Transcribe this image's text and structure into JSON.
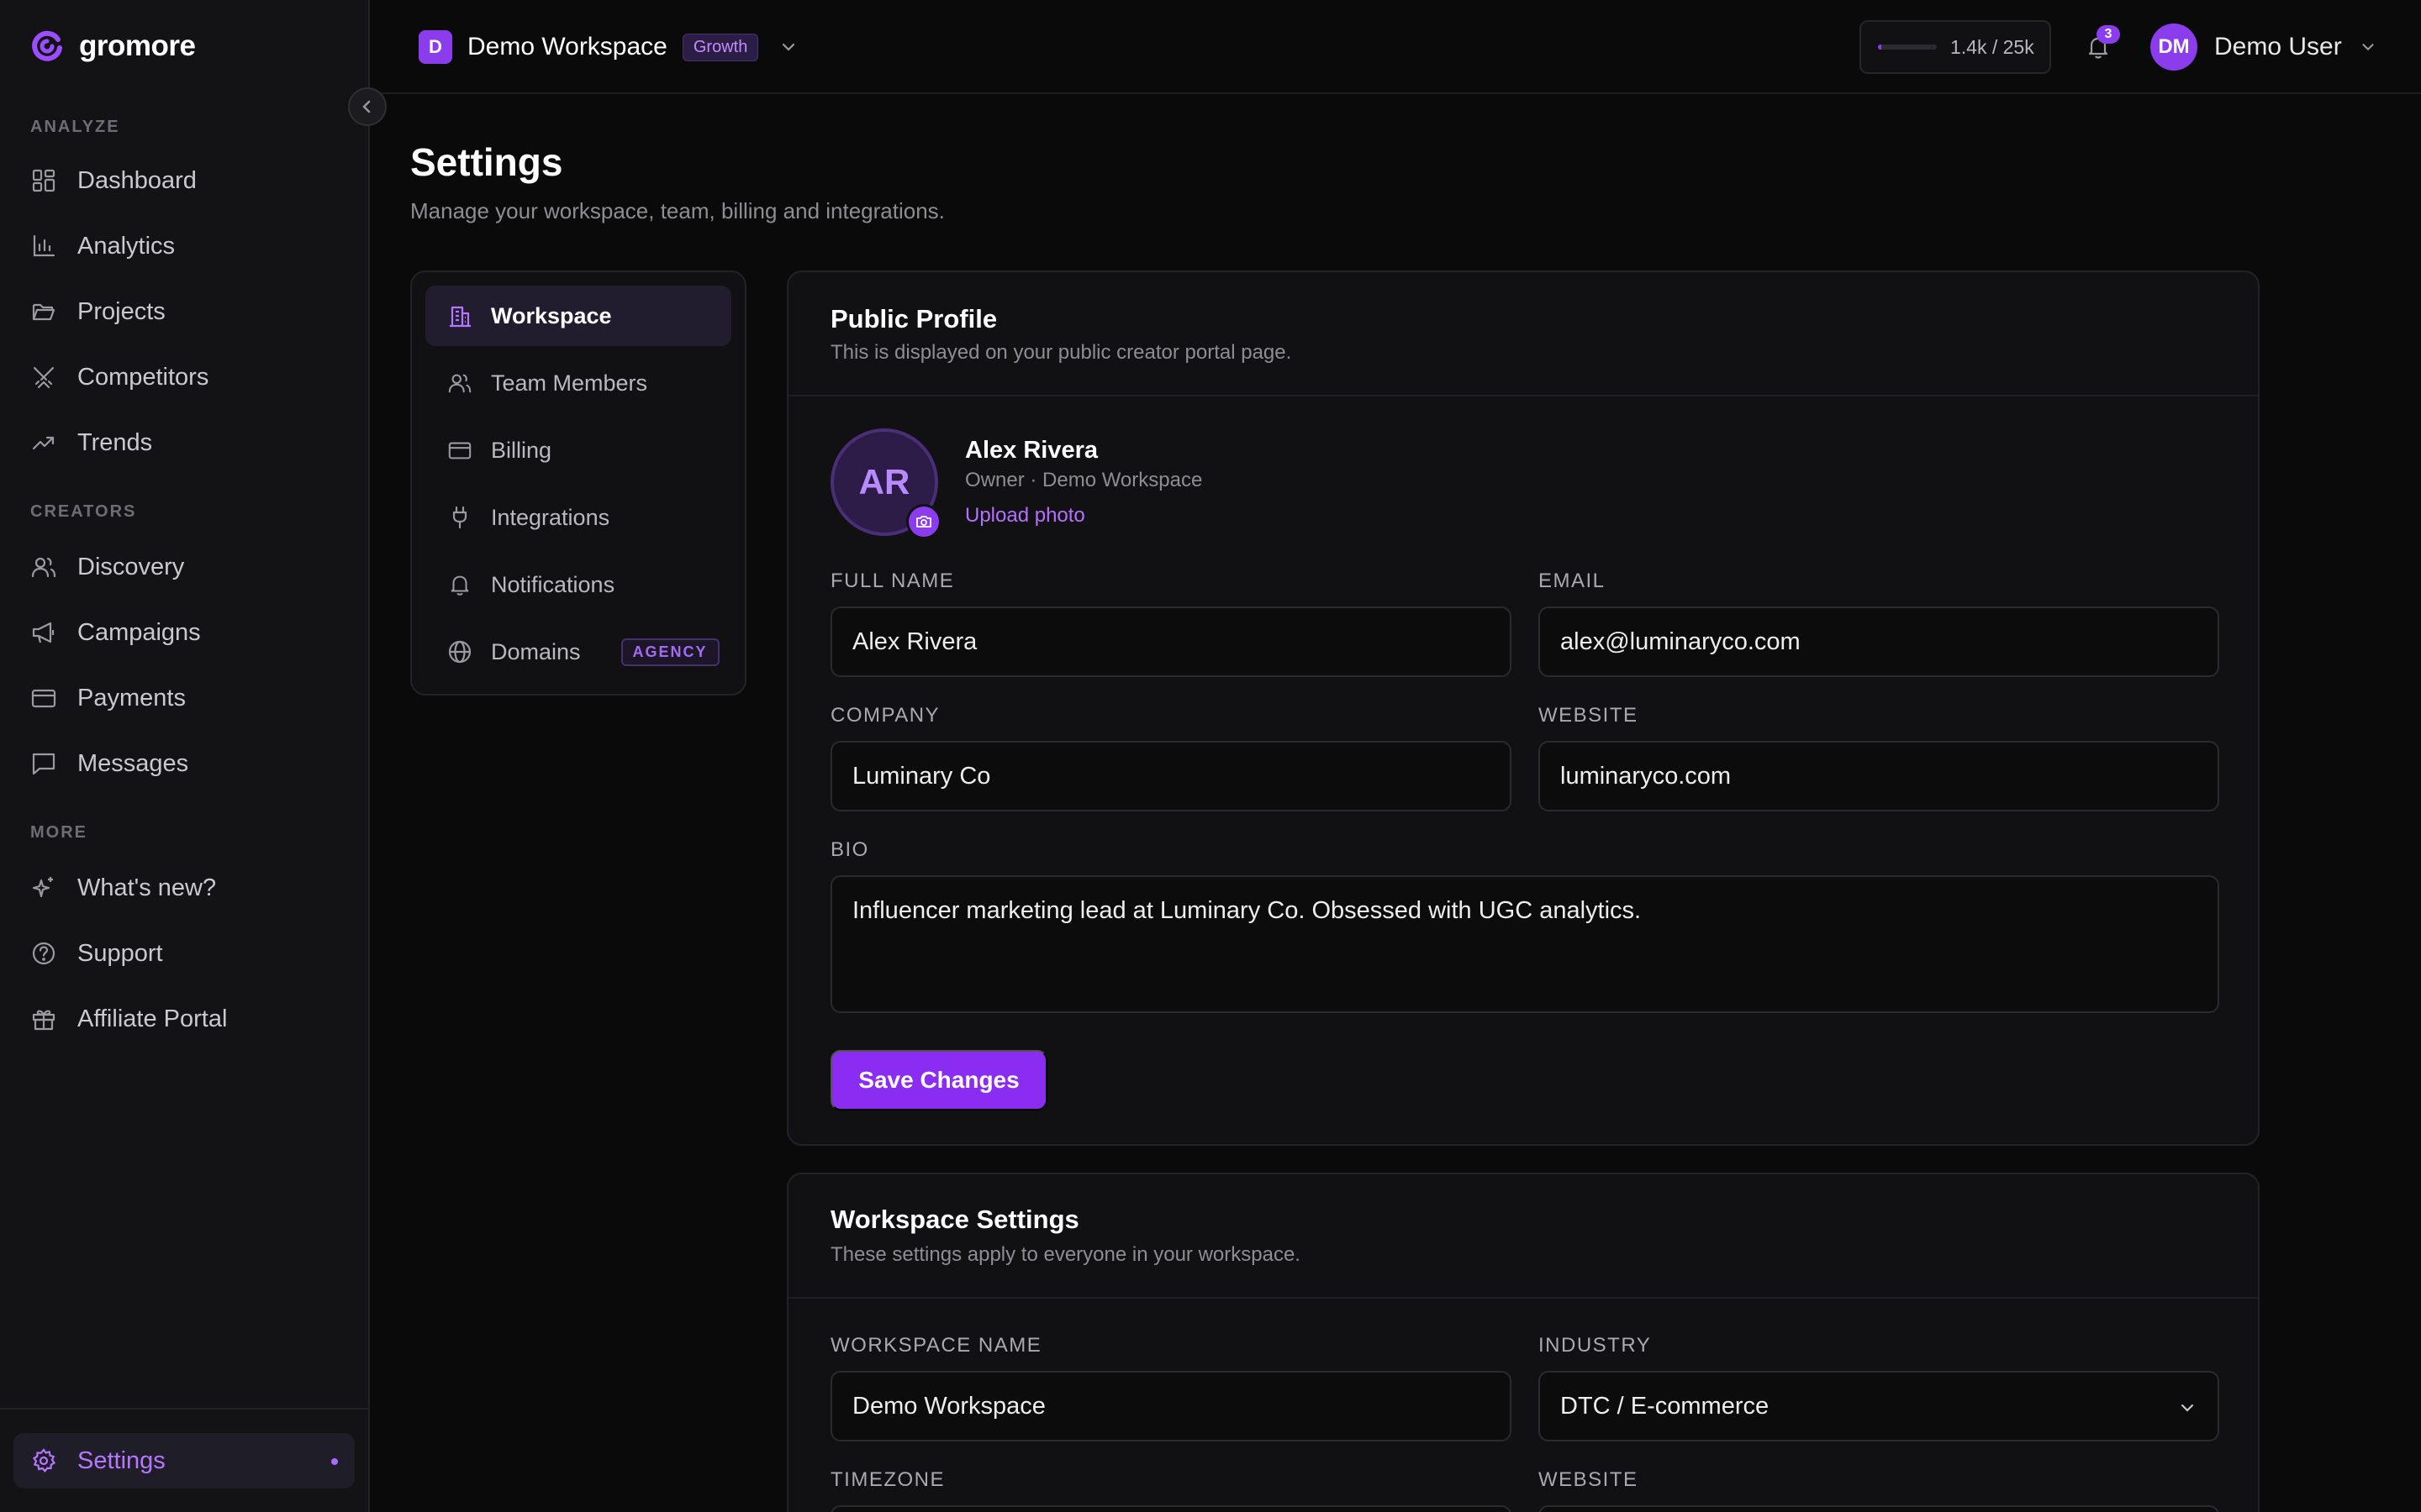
{
  "app": {
    "logo_text": "gromore"
  },
  "sidebar": {
    "sections": [
      {
        "label": "ANALYZE"
      },
      {
        "label": "CREATORS"
      },
      {
        "label": "MORE"
      }
    ],
    "items": [
      {
        "label": "Dashboard",
        "icon": "dashboard-icon"
      },
      {
        "label": "Analytics",
        "icon": "analytics-icon"
      },
      {
        "label": "Projects",
        "icon": "folder-icon"
      },
      {
        "label": "Competitors",
        "icon": "swords-icon"
      },
      {
        "label": "Trends",
        "icon": "trending-up-icon"
      },
      {
        "label": "Discovery",
        "icon": "users-icon"
      },
      {
        "label": "Campaigns",
        "icon": "megaphone-icon"
      },
      {
        "label": "Payments",
        "icon": "credit-card-icon"
      },
      {
        "label": "Messages",
        "icon": "message-icon"
      },
      {
        "label": "What's new?",
        "icon": "sparkles-icon"
      },
      {
        "label": "Support",
        "icon": "help-circle-icon"
      },
      {
        "label": "Affiliate Portal",
        "icon": "gift-icon"
      }
    ],
    "settings": {
      "label": "Settings",
      "icon": "gear-icon",
      "active": true
    }
  },
  "topbar": {
    "workspace_initial": "D",
    "workspace_name": "Demo Workspace",
    "plan": "Growth",
    "usage_text": "1.4k / 25k",
    "usage_fraction": 0.056,
    "notification_count": "3",
    "user_initials": "DM",
    "user_name": "Demo User"
  },
  "page": {
    "title": "Settings",
    "subtitle": "Manage your workspace, team, billing and integrations."
  },
  "settings_nav": [
    {
      "label": "Workspace",
      "icon": "building-icon",
      "active": true
    },
    {
      "label": "Team Members",
      "icon": "users-icon"
    },
    {
      "label": "Billing",
      "icon": "credit-card-icon"
    },
    {
      "label": "Integrations",
      "icon": "plug-icon"
    },
    {
      "label": "Notifications",
      "icon": "bell-icon"
    },
    {
      "label": "Domains",
      "icon": "globe-icon",
      "badge": "AGENCY"
    }
  ],
  "public_profile": {
    "title": "Public Profile",
    "subtitle": "This is displayed on your public creator portal page.",
    "avatar_initials": "AR",
    "name": "Alex Rivera",
    "role": "Owner · Demo Workspace",
    "upload_label": "Upload photo",
    "fields": {
      "full_name": {
        "label": "FULL NAME",
        "value": "Alex Rivera"
      },
      "email": {
        "label": "EMAIL",
        "value": "alex@luminaryco.com"
      },
      "company": {
        "label": "COMPANY",
        "value": "Luminary Co"
      },
      "website": {
        "label": "WEBSITE",
        "value": "luminaryco.com"
      },
      "bio": {
        "label": "BIO",
        "value": "Influencer marketing lead at Luminary Co. Obsessed with UGC analytics."
      }
    },
    "save_label": "Save Changes"
  },
  "workspace_settings": {
    "title": "Workspace Settings",
    "subtitle": "These settings apply to everyone in your workspace.",
    "fields": {
      "workspace_name": {
        "label": "WORKSPACE NAME",
        "value": "Demo Workspace"
      },
      "industry": {
        "label": "INDUSTRY",
        "value": "DTC / E-commerce"
      },
      "timezone": {
        "label": "TIMEZONE"
      },
      "website": {
        "label": "WEBSITE"
      }
    }
  },
  "colors": {
    "accent": "#8b3ded",
    "accent_text": "#b570ff",
    "background": "#0a0a0a"
  }
}
